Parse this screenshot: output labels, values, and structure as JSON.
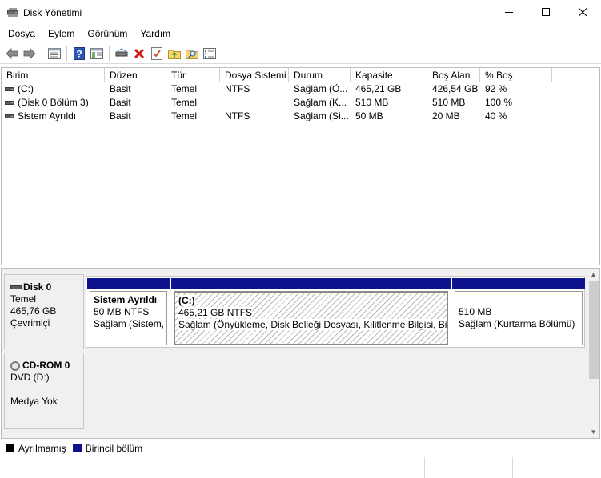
{
  "window": {
    "title": "Disk Yönetimi",
    "app_icon": "disk-management-icon",
    "controls": [
      "minimize-icon",
      "maximize-icon",
      "close-icon"
    ]
  },
  "menu": [
    {
      "label": "Dosya"
    },
    {
      "label": "Eylem"
    },
    {
      "label": "Görünüm"
    },
    {
      "label": "Yardım"
    }
  ],
  "toolbar": [
    "back-arrow-icon",
    "forward-arrow-icon",
    "sep",
    "properties-list-icon",
    "sep",
    "help-icon",
    "console-view-icon",
    "sep",
    "connect-disk-icon",
    "delete-icon",
    "check-icon",
    "refresh-folder-icon",
    "search-icon",
    "list-view-icon"
  ],
  "volume_list": {
    "columns": [
      "Birim",
      "Düzen",
      "Tür",
      "Dosya Sistemi",
      "Durum",
      "Kapasite",
      "Boş Alan",
      "% Boş"
    ],
    "rows": [
      [
        "(C:)",
        "Basit",
        "Temel",
        "NTFS",
        "Sağlam (Ö...",
        "465,21 GB",
        "426,54 GB",
        "92 %"
      ],
      [
        "(Disk 0 Bölüm 3)",
        "Basit",
        "Temel",
        "",
        "Sağlam (K...",
        "510 MB",
        "510 MB",
        "100 %"
      ],
      [
        "Sistem Ayrıldı",
        "Basit",
        "Temel",
        "NTFS",
        "Sağlam (Si...",
        "50 MB",
        "20 MB",
        "40 %"
      ]
    ]
  },
  "disks": {
    "disk0": {
      "name": "Disk 0",
      "type": "Temel",
      "size": "465,76 GB",
      "status": "Çevrimiçi",
      "partitions": [
        {
          "name": "Sistem Ayrıldı",
          "size": "50 MB NTFS",
          "status": "Sağlam (Sistem, I"
        },
        {
          "name": "(C:)",
          "size": "465,21 GB NTFS",
          "status": "Sağlam (Önyükleme, Disk Belleği Dosyası, Kilitlenme Bilgisi, Birin"
        },
        {
          "name": "",
          "size": "510 MB",
          "status": "Sağlam (Kurtarma Bölümü)"
        }
      ]
    },
    "cdrom0": {
      "name": "CD-ROM 0",
      "type": "DVD (D:)",
      "media": "Medya Yok"
    }
  },
  "legend": [
    {
      "label": "Ayrılmamış",
      "color": "#000000"
    },
    {
      "label": "Birincil bölüm",
      "color": "#0c138c"
    }
  ]
}
